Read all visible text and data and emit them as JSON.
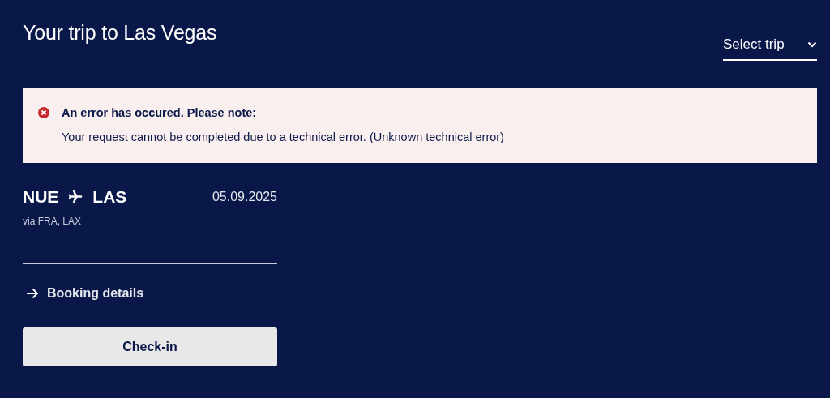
{
  "header": {
    "title": "Your trip to Las Vegas",
    "trip_select": {
      "label": "Select trip"
    }
  },
  "alert": {
    "title": "An error has occured. Please note:",
    "message": "Your request cannot be completed due to a technical error. (Unknown technical error)"
  },
  "trip": {
    "origin": "NUE",
    "destination": "LAS",
    "date": "05.09.2025",
    "via": "via FRA, LAX"
  },
  "booking_details_link": "Booking details",
  "checkin_button": "Check-in"
}
